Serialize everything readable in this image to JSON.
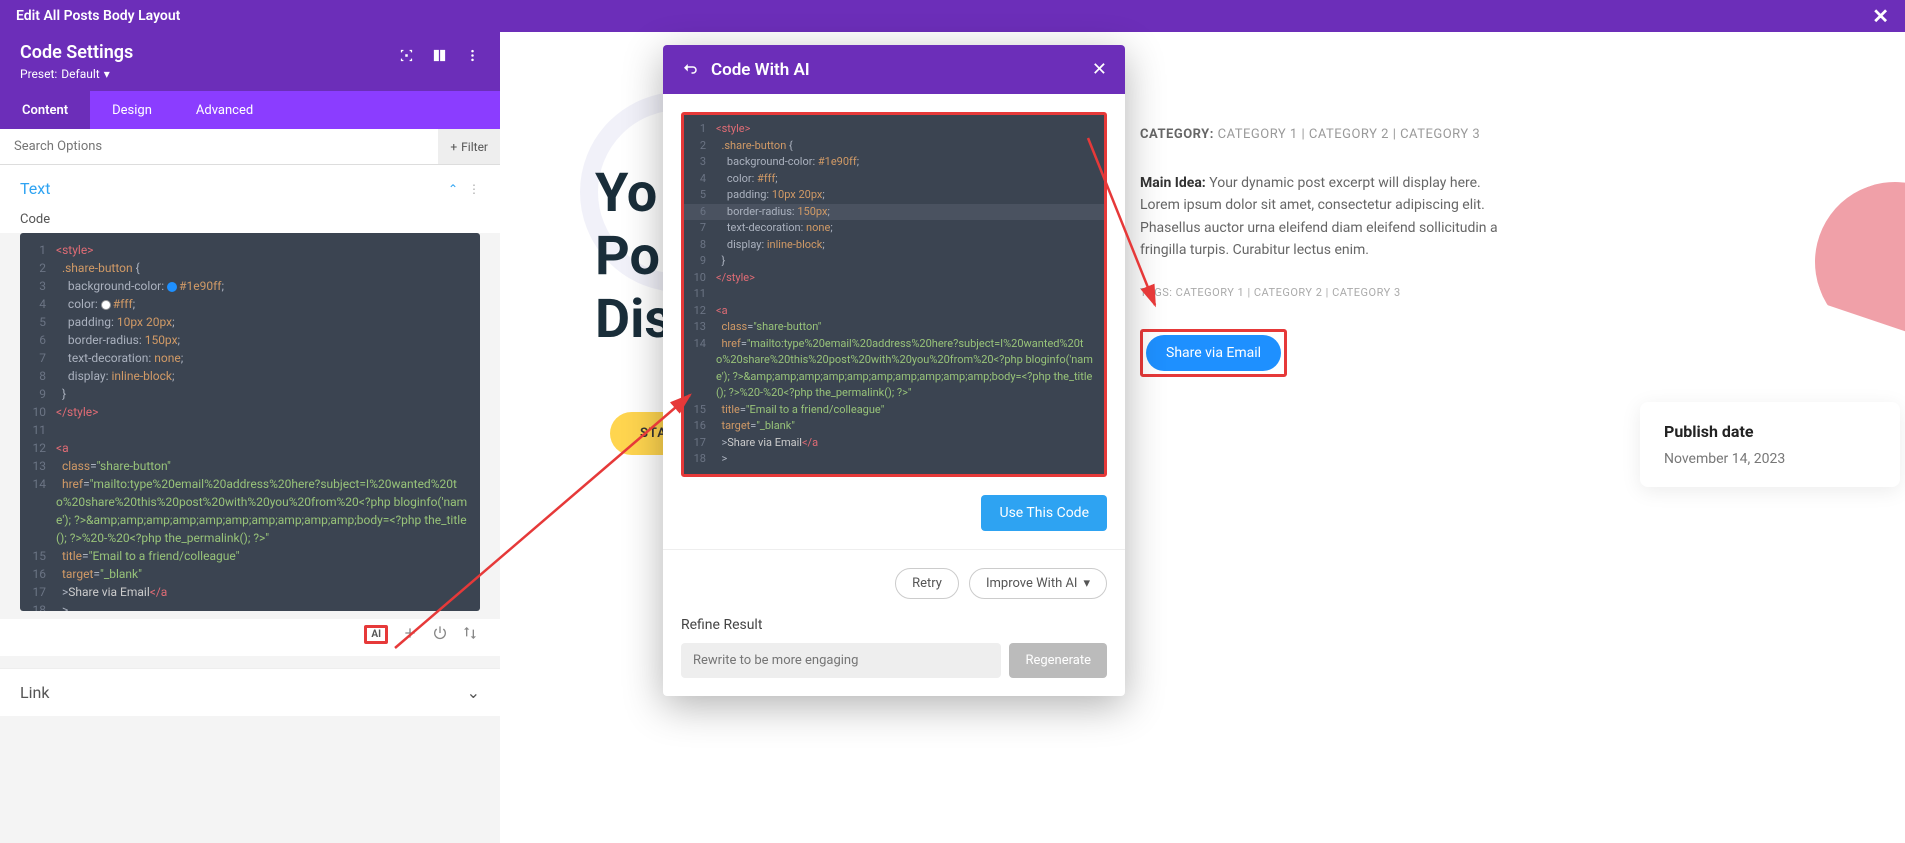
{
  "topbar": {
    "title": "Edit All Posts Body Layout"
  },
  "settings": {
    "title": "Code Settings",
    "preset_label": "Preset:",
    "preset_value": "Default"
  },
  "tabs": {
    "content": "Content",
    "design": "Design",
    "advanced": "Advanced"
  },
  "search": {
    "placeholder": "Search Options",
    "filter": "Filter"
  },
  "text_section": {
    "title": "Text",
    "code_label": "Code"
  },
  "link_section": {
    "title": "Link"
  },
  "ai_modal": {
    "title": "Code With AI",
    "use_btn": "Use This Code",
    "retry": "Retry",
    "improve": "Improve With AI",
    "refine_label": "Refine Result",
    "refine_placeholder": "Rewrite to be more engaging",
    "regenerate": "Regenerate"
  },
  "code": {
    "l1": "<style>",
    "l2_sel": ".share-button",
    "l3_p": "background-color",
    "l3_v": "#1e90ff",
    "l4_p": "color",
    "l4_v": "#fff",
    "l5_p": "padding",
    "l5_v": "10px 20px",
    "l6_p": "border-radius",
    "l6_v": "150px",
    "l7_p": "text-decoration",
    "l7_v": "none",
    "l8_p": "display",
    "l8_v": "inline-block",
    "l10": "</style>",
    "l12": "<a",
    "l13_a": "class",
    "l13_v": "share-button",
    "l14_a": "href",
    "l14_v": "mailto:type%20email%20address%20here?subject=I%20wanted%20to%20share%20this%20post%20with%20you%20from%20<?php bloginfo('name'); ?>&amp;amp;amp;amp;amp;amp;amp;amp;amp;amp;body=<?php the_title(); ?>%20-%20<?php the_permalink(); ?>",
    "l15_a": "title",
    "l15_v": "Email to a friend/colleague",
    "l16_a": "target",
    "l16_v": "_blank",
    "l17_t": "Share via Email",
    "l17_c": "</a"
  },
  "preview": {
    "hero_l1": "Yo",
    "hero_l2": "Po",
    "hero_l3": "Dis",
    "start": "START R",
    "cat_label": "CATEGORY:",
    "cat_vals": "CATEGORY 1 | CATEGORY 2 | CATEGORY 3",
    "idea_label": "Main Idea:",
    "idea_text": "Your dynamic post excerpt will display here. Lorem ipsum dolor sit amet, consectetur adipiscing elit. Phasellus auctor urna eleifend diam eleifend sollicitudin a fringilla turpis. Curabitur lectus enim.",
    "tags": "TAGS: CATEGORY 1 | CATEGORY 2 | CATEGORY 3",
    "share_btn": "Share via Email",
    "date_label": "Publish date",
    "date_val": "November 14, 2023"
  }
}
